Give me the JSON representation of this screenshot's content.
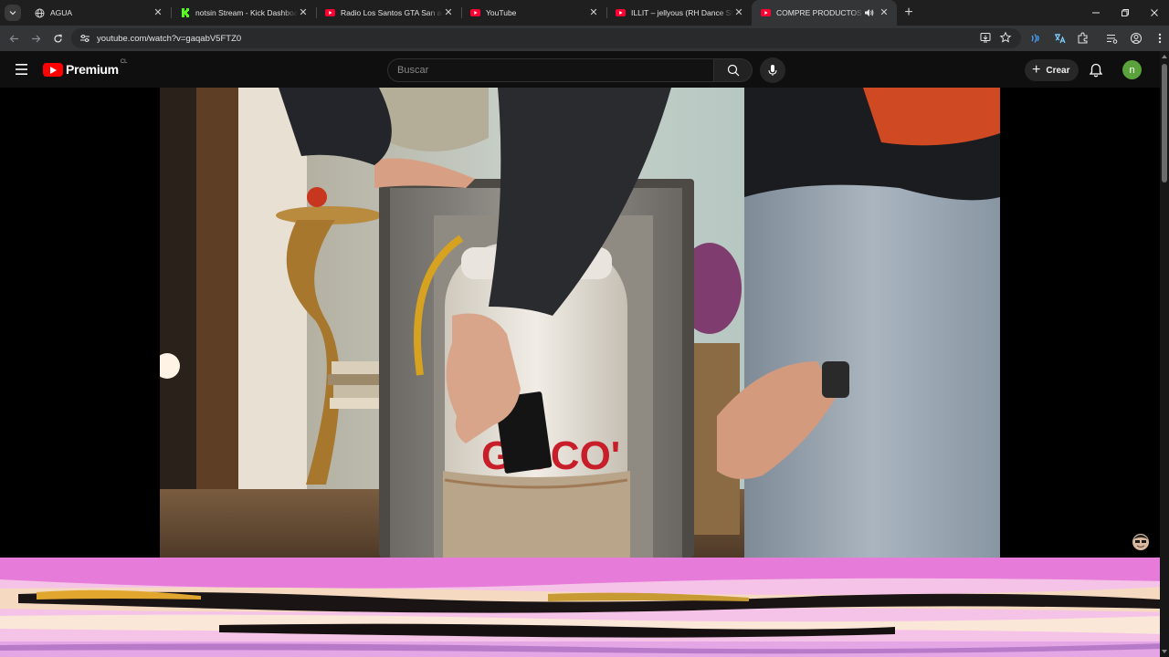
{
  "browser": {
    "tabs": [
      {
        "title": "AGUA",
        "favicon": "globe-icon",
        "active": false
      },
      {
        "title": "notsin Stream - Kick Dashboard",
        "favicon": "kick-icon",
        "active": false
      },
      {
        "title": "Radio Los Santos GTA San andreas",
        "favicon": "youtube-icon",
        "active": false
      },
      {
        "title": "YouTube",
        "favicon": "youtube-icon",
        "active": false
      },
      {
        "title": "ILLIT – jellyous (RH Dance Studio",
        "favicon": "youtube-icon",
        "active": false
      },
      {
        "title": "COMPRE PRODUCTOS de TEMU",
        "favicon": "youtube-icon",
        "active": true,
        "audio": true
      }
    ],
    "url": "youtube.com/watch?v=gaqabV5FTZ0"
  },
  "youtube": {
    "logo_text": "Premium",
    "country_code": "CL",
    "search_placeholder": "Buscar",
    "create_label": "Crear",
    "avatar_letter": "n"
  },
  "colors": {
    "tab_bg": "#1f1f1f",
    "toolbar_bg": "#333537",
    "youtube_red": "#ff0000",
    "avatar_green": "#5aa23b",
    "page_bg": "#0f0f0f"
  }
}
